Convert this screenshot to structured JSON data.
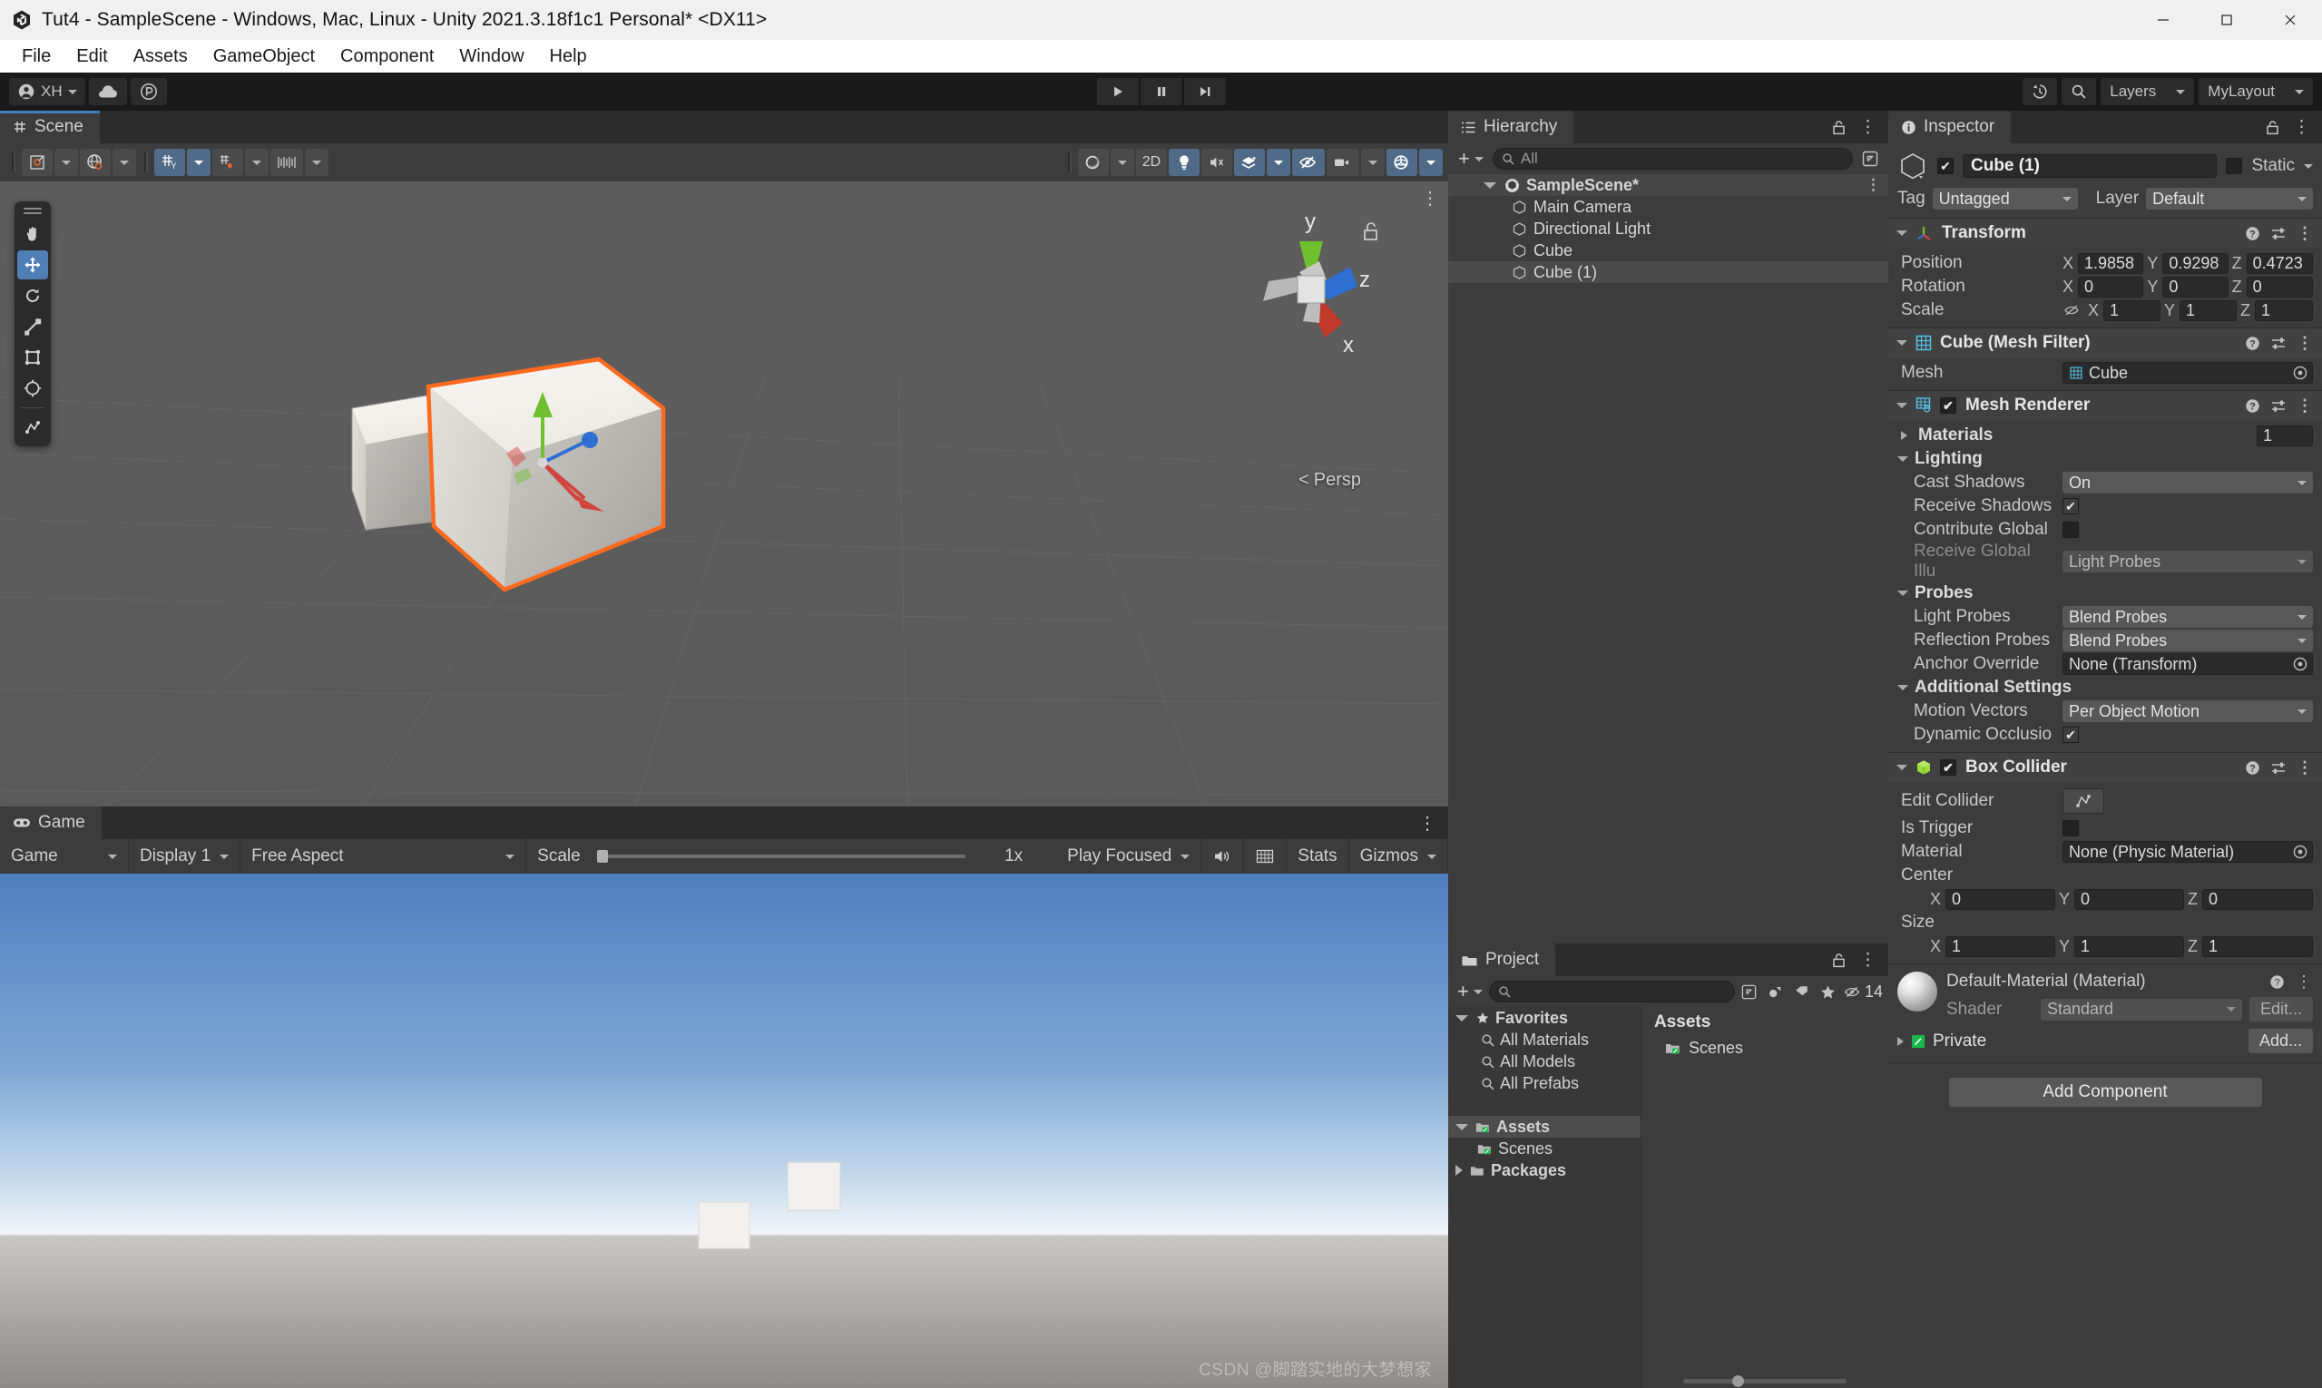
{
  "window": {
    "title": "Tut4 - SampleScene - Windows, Mac, Linux - Unity 2021.3.18f1c1 Personal* <DX11>",
    "minimize_label": "Minimize",
    "maximize_label": "Maximize",
    "close_label": "Close"
  },
  "menubar": {
    "items": [
      {
        "label": "File"
      },
      {
        "label": "Edit"
      },
      {
        "label": "Assets"
      },
      {
        "label": "GameObject"
      },
      {
        "label": "Component"
      },
      {
        "label": "Window"
      },
      {
        "label": "Help"
      }
    ]
  },
  "toolbar": {
    "account_label": "XH",
    "cloud_label": "Unity Cloud",
    "collab_label": "Collab",
    "play_label": "Play",
    "pause_label": "Pause",
    "step_label": "Step",
    "history_label": "Undo History",
    "search_label": "Search",
    "layers_label": "Layers",
    "layout_label": "MyLayout"
  },
  "scene_panel": {
    "tab_label": "Scene",
    "toolbar": {
      "view_tool": "Draw Mode",
      "shading_tool": "Shading Mode",
      "grid_label": "Grid Y",
      "snap_label": "Snap Increment",
      "gizmo_label": "Gizmos",
      "audio_label": "Audio",
      "twod_label": "2D",
      "light_label": "Scene Lighting",
      "fx_label": "Effects",
      "hidden_label": "Hidden Objects",
      "camera_label": "Scene Camera",
      "gizmos_label": "Gizmos Menu"
    },
    "tools": [
      {
        "name": "hand-tool",
        "label": "Hand Tool",
        "active": false
      },
      {
        "name": "move-tool",
        "label": "Move Tool",
        "active": true
      },
      {
        "name": "rotate-tool",
        "label": "Rotate Tool",
        "active": false
      },
      {
        "name": "scale-tool",
        "label": "Scale Tool",
        "active": false
      },
      {
        "name": "rect-tool",
        "label": "Rect Tool",
        "active": false
      },
      {
        "name": "transform-tool",
        "label": "Transform Tool",
        "active": false
      },
      {
        "name": "custom-tool",
        "label": "Custom Editor Tool",
        "active": false
      }
    ],
    "gizmo": {
      "axis_y": "y",
      "axis_z": "z",
      "axis_x": "x",
      "projection": "Persp"
    }
  },
  "game_panel": {
    "tab_label": "Game",
    "mode": "Game",
    "display": "Display 1",
    "aspect": "Free Aspect",
    "scale_label": "Scale",
    "scale_value": "1x",
    "play_mode": "Play Focused",
    "mute_label": "Mute Audio",
    "stats_label": "Stats",
    "gizmos_label": "Gizmos"
  },
  "hierarchy": {
    "tab_label": "Hierarchy",
    "add_label": "+",
    "search_placeholder": "All",
    "items": [
      {
        "label": "SampleScene*",
        "depth": 0,
        "icon": "scene-icon",
        "selected": false,
        "root": true
      },
      {
        "label": "Main Camera",
        "depth": 1,
        "icon": "gameobject-icon",
        "selected": false,
        "root": false
      },
      {
        "label": "Directional Light",
        "depth": 1,
        "icon": "gameobject-icon",
        "selected": false,
        "root": false
      },
      {
        "label": "Cube",
        "depth": 1,
        "icon": "gameobject-icon",
        "selected": false,
        "root": false
      },
      {
        "label": "Cube (1)",
        "depth": 1,
        "icon": "gameobject-icon",
        "selected": true,
        "root": false
      }
    ]
  },
  "project": {
    "tab_label": "Project",
    "search_placeholder": "",
    "hidden_count": "14",
    "tree": [
      {
        "label": "Favorites",
        "depth": 0,
        "icon": "star-icon",
        "expanded": true,
        "selected": false
      },
      {
        "label": "All Materials",
        "depth": 1,
        "icon": "search-icon",
        "expanded": false,
        "selected": false
      },
      {
        "label": "All Models",
        "depth": 1,
        "icon": "search-icon",
        "expanded": false,
        "selected": false
      },
      {
        "label": "All Prefabs",
        "depth": 1,
        "icon": "search-icon",
        "expanded": false,
        "selected": false
      },
      {
        "label": "Assets",
        "depth": 0,
        "icon": "folder-vcs-icon",
        "expanded": true,
        "selected": true
      },
      {
        "label": "Scenes",
        "depth": 1,
        "icon": "folder-vcs-icon",
        "expanded": false,
        "selected": false
      },
      {
        "label": "Packages",
        "depth": 0,
        "icon": "folder-icon",
        "expanded": false,
        "selected": false
      }
    ],
    "content_header": "Assets",
    "content_items": [
      {
        "label": "Scenes",
        "icon": "folder-vcs-icon"
      }
    ]
  },
  "inspector": {
    "tab_label": "Inspector",
    "object_name": "Cube (1)",
    "object_enabled": true,
    "static_label": "Static",
    "static_checked": false,
    "tag_label": "Tag",
    "tag_value": "Untagged",
    "layer_label": "Layer",
    "layer_value": "Default",
    "transform": {
      "title": "Transform",
      "position_label": "Position",
      "position": {
        "x": "1.9858",
        "y": "0.9298",
        "z": "0.4723"
      },
      "rotation_label": "Rotation",
      "rotation": {
        "x": "0",
        "y": "0",
        "z": "0"
      },
      "scale_label": "Scale",
      "scale": {
        "x": "1",
        "y": "1",
        "z": "1"
      }
    },
    "mesh_filter": {
      "title": "Cube (Mesh Filter)",
      "mesh_label": "Mesh",
      "mesh_value": "Cube"
    },
    "mesh_renderer": {
      "title": "Mesh Renderer",
      "enabled": true,
      "materials_label": "Materials",
      "materials_count": "1",
      "lighting_label": "Lighting",
      "cast_shadows_label": "Cast Shadows",
      "cast_shadows_value": "On",
      "receive_shadows_label": "Receive Shadows",
      "receive_shadows_checked": true,
      "contribute_global_label": "Contribute Global",
      "contribute_global_checked": false,
      "receive_gi_label": "Receive Global Illu",
      "receive_gi_value": "Light Probes",
      "probes_label": "Probes",
      "light_probes_label": "Light Probes",
      "light_probes_value": "Blend Probes",
      "reflection_probes_label": "Reflection Probes",
      "reflection_probes_value": "Blend Probes",
      "anchor_override_label": "Anchor Override",
      "anchor_override_value": "None (Transform)",
      "additional_settings_label": "Additional Settings",
      "motion_vectors_label": "Motion Vectors",
      "motion_vectors_value": "Per Object Motion",
      "dynamic_occlusion_label": "Dynamic Occlusio",
      "dynamic_occlusion_checked": true
    },
    "box_collider": {
      "title": "Box Collider",
      "enabled": true,
      "edit_collider_label": "Edit Collider",
      "is_trigger_label": "Is Trigger",
      "is_trigger_checked": false,
      "material_label": "Material",
      "material_value": "None (Physic Material)",
      "center_label": "Center",
      "center": {
        "x": "0",
        "y": "0",
        "z": "0"
      },
      "size_label": "Size",
      "size": {
        "x": "1",
        "y": "1",
        "z": "1"
      }
    },
    "material": {
      "title": "Default-Material (Material)",
      "shader_label": "Shader",
      "shader_value": "Standard",
      "edit_label": "Edit...",
      "private_label": "Private",
      "add_label": "Add..."
    },
    "add_component_label": "Add Component"
  },
  "watermark": "CSDN @脚踏实地的大梦想家",
  "colors": {
    "accent_blue": "#4f7fb5",
    "selection_orange": "#ff6a1e",
    "axis_x": "#d1453f",
    "axis_y": "#6fbf2f",
    "axis_z": "#2f6fd1",
    "panel_bg": "#3c3c3c",
    "toolbar_bg": "#191919"
  }
}
